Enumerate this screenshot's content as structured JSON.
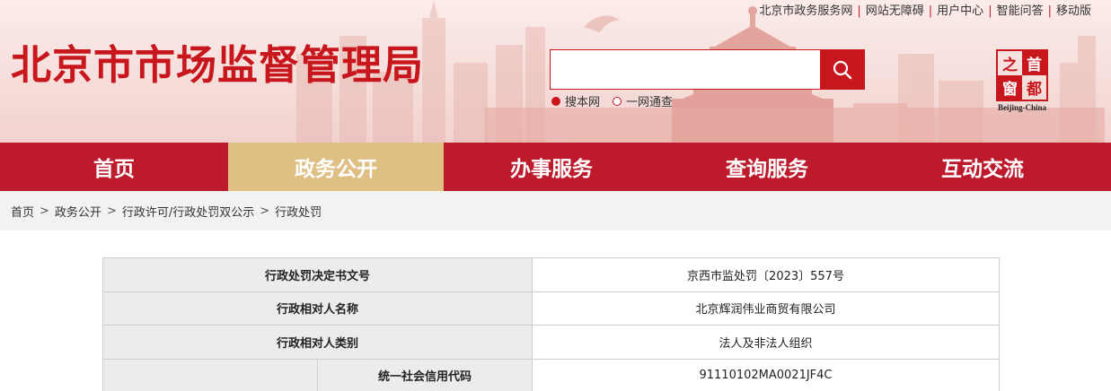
{
  "header": {
    "site_title": "北京市市场监督管理局",
    "top_links": [
      "北京市政务服务网",
      "网站无障碍",
      "用户中心",
      "智能问答",
      "移动版"
    ],
    "search": {
      "placeholder": "",
      "scope_options": [
        "搜本网",
        "一网通查"
      ],
      "selected_scope": "搜本网"
    },
    "logo": {
      "chars": [
        "之",
        "首",
        "窗",
        "都"
      ],
      "caption": "Beijing-China"
    },
    "colors": {
      "brand_red": "#c8161d",
      "nav_red": "#bd1a2c",
      "nav_active": "#dfbf83"
    }
  },
  "nav": {
    "items": [
      "首页",
      "政务公开",
      "办事服务",
      "查询服务",
      "互动交流"
    ],
    "active": "政务公开"
  },
  "breadcrumb": [
    "首页",
    "政务公开",
    "行政许可/行政处罚双公示",
    "行政处罚"
  ],
  "detail_table": {
    "rows": [
      {
        "label": "行政处罚决定书文号",
        "value": "京西市监处罚〔2023〕557号"
      },
      {
        "label": "行政相对人名称",
        "value": "北京辉润伟业商贸有限公司"
      },
      {
        "label": "行政相对人类别",
        "value": "法人及非法人组织"
      },
      {
        "label": "统一社会信用代码",
        "value": "91110102MA0021JF4C"
      }
    ]
  }
}
